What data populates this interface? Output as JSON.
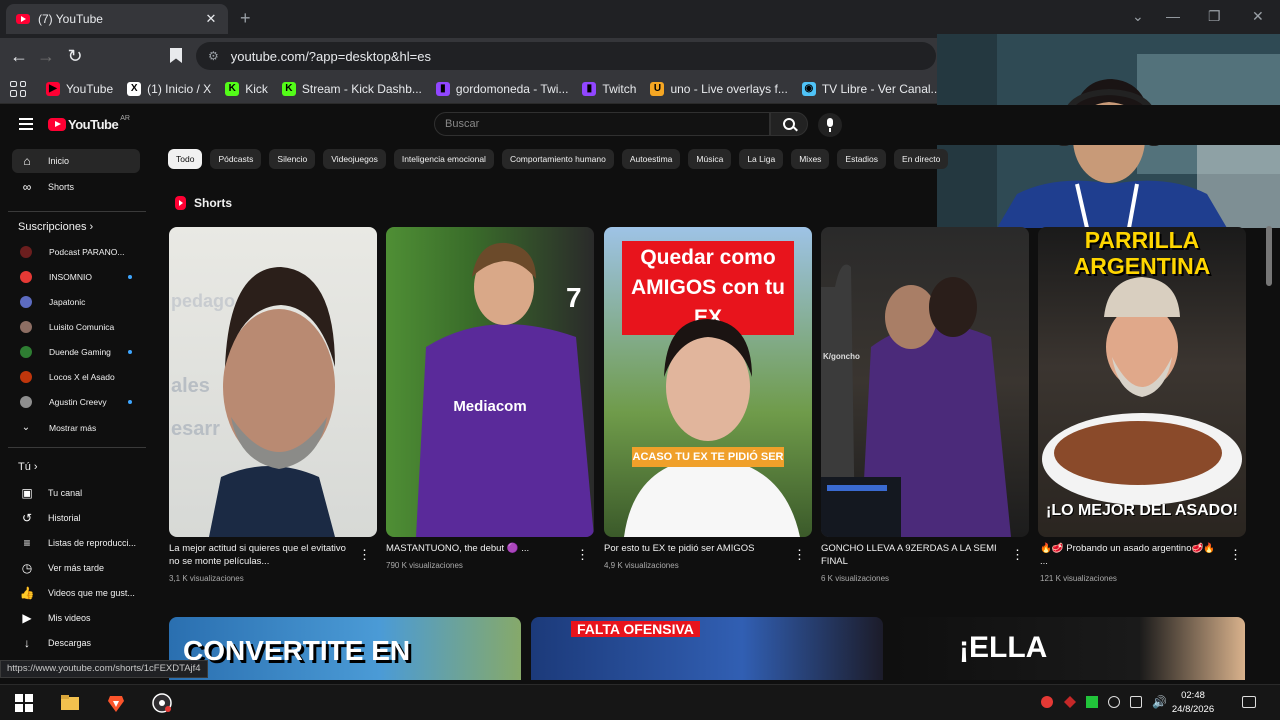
{
  "browser": {
    "tab_title": "(7) YouTube",
    "tab_close": "✕",
    "new_tab": "+",
    "url": "youtube.com/?app=desktop&hl=es",
    "status_url": "https://www.youtube.com/shorts/1cFEXDTAjf4",
    "controls": {
      "chevron": "⌄",
      "minimize": "—",
      "maximize": "❐",
      "close": "✕"
    },
    "nav": {
      "back": "←",
      "forward": "→",
      "reload": "↻"
    }
  },
  "bookmarks": [
    {
      "label": "YouTube",
      "color": "#ff0033",
      "glyph": "▶"
    },
    {
      "label": "(1) Inicio / X",
      "color": "#ffffff",
      "glyph": "X"
    },
    {
      "label": "Kick",
      "color": "#53fc18",
      "glyph": "K"
    },
    {
      "label": "Stream - Kick Dashb...",
      "color": "#53fc18",
      "glyph": "K"
    },
    {
      "label": "gordomoneda - Twi...",
      "color": "#9146ff",
      "glyph": "▮"
    },
    {
      "label": "Twitch",
      "color": "#9146ff",
      "glyph": "▮"
    },
    {
      "label": "uno - Live overlays f...",
      "color": "#f5a623",
      "glyph": "U"
    },
    {
      "label": "TV Libre - Ver Canal...",
      "color": "#4fc3f7",
      "glyph": "◉"
    }
  ],
  "youtube": {
    "logo_word": "YouTube",
    "logo_region": "AR",
    "search_placeholder": "Buscar",
    "sidebar": {
      "main": [
        {
          "label": "Inicio",
          "icon": "⌂"
        },
        {
          "label": "Shorts",
          "icon": "∞"
        }
      ],
      "subscriptions_title": "Suscripciones",
      "subscriptions": [
        {
          "label": "Podcast PARANO...",
          "color": "#6b1e1e",
          "dot": false
        },
        {
          "label": "INSOMNIO",
          "color": "#e53935",
          "dot": true
        },
        {
          "label": "Japatonic",
          "color": "#5c6bc0",
          "dot": false
        },
        {
          "label": "Luisito Comunica",
          "color": "#8d6e63",
          "dot": false
        },
        {
          "label": "Duende Gaming",
          "color": "#2e7d32",
          "dot": true
        },
        {
          "label": "Locos X el Asado",
          "color": "#bf360c",
          "dot": false
        },
        {
          "label": "Agustin Creevy",
          "color": "#8e8e8e",
          "dot": true
        }
      ],
      "show_more": "Mostrar más",
      "you_title": "Tú",
      "you": [
        {
          "label": "Tu canal",
          "icon": "▣"
        },
        {
          "label": "Historial",
          "icon": "↺"
        },
        {
          "label": "Listas de reproducci...",
          "icon": "≡"
        },
        {
          "label": "Ver más tarde",
          "icon": "◷"
        },
        {
          "label": "Videos que me gust...",
          "icon": "👍"
        },
        {
          "label": "Mis videos",
          "icon": "▶"
        },
        {
          "label": "Descargas",
          "icon": "↓"
        }
      ]
    },
    "chips": [
      "Todo",
      "Pódcasts",
      "Silencio",
      "Videojuegos",
      "Inteligencia emocional",
      "Comportamiento humano",
      "Autoestima",
      "Música",
      "La Liga",
      "Mixes",
      "Estadios",
      "En directo"
    ],
    "shorts_title": "Shorts",
    "shorts": [
      {
        "title": "La mejor actitud si quieres que el evitativo no se monte películas...",
        "views": "3,1 K visualizaciones",
        "overlay": ""
      },
      {
        "title": "MASTANTUONO, the debut 🟣 ...",
        "views": "790 K visualizaciones",
        "overlay": "Mediacom"
      },
      {
        "title": "Por esto tu EX te pidió ser AMIGOS",
        "views": "4,9 K visualizaciones",
        "overlay": "Quedar como AMIGOS con tu EX",
        "overlay2": "ACASO TU EX TE PIDIÓ SER"
      },
      {
        "title": "GONCHO LLEVA A 9ZERDAS A LA SEMI FINAL",
        "views": "6 K visualizaciones",
        "overlay": "K/goncho"
      },
      {
        "title": "🔥🥩 Probando un asado argentino🥩🔥 ...",
        "views": "121 K visualizaciones",
        "overlay": "PARRILLA ARGENTINA",
        "overlay2": "¡LO MEJOR DEL ASADO!"
      }
    ],
    "bottom_videos": [
      "CONVERTITE EN",
      "FALTA  OFENSIVA",
      "¡ELLA"
    ]
  },
  "taskbar": {
    "time": "02:48",
    "date": "24/8/2026"
  }
}
